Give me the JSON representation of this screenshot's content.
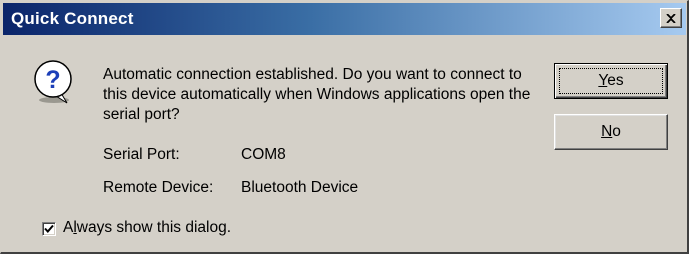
{
  "window": {
    "title": "Quick Connect"
  },
  "icons": {
    "dialog_icon": "question-icon",
    "close": "close-icon"
  },
  "message": "Automatic connection established.  Do you want to connect to this device automatically when Windows applications open the serial port?",
  "details": {
    "serial_port_label": "Serial Port:",
    "serial_port_value": "COM8",
    "remote_device_label": "Remote Device:",
    "remote_device_value": "Bluetooth Device"
  },
  "buttons": {
    "yes": {
      "label": "Yes",
      "mnemonic": "Y"
    },
    "no": {
      "label": "No",
      "mnemonic": "N"
    }
  },
  "checkbox": {
    "label": "Always show this dialog.",
    "mnemonic": "l",
    "checked": true
  },
  "colors": {
    "title_gradient_start": "#0a246a",
    "title_gradient_end": "#a6caf0",
    "dialog_face": "#d4d0c8"
  }
}
